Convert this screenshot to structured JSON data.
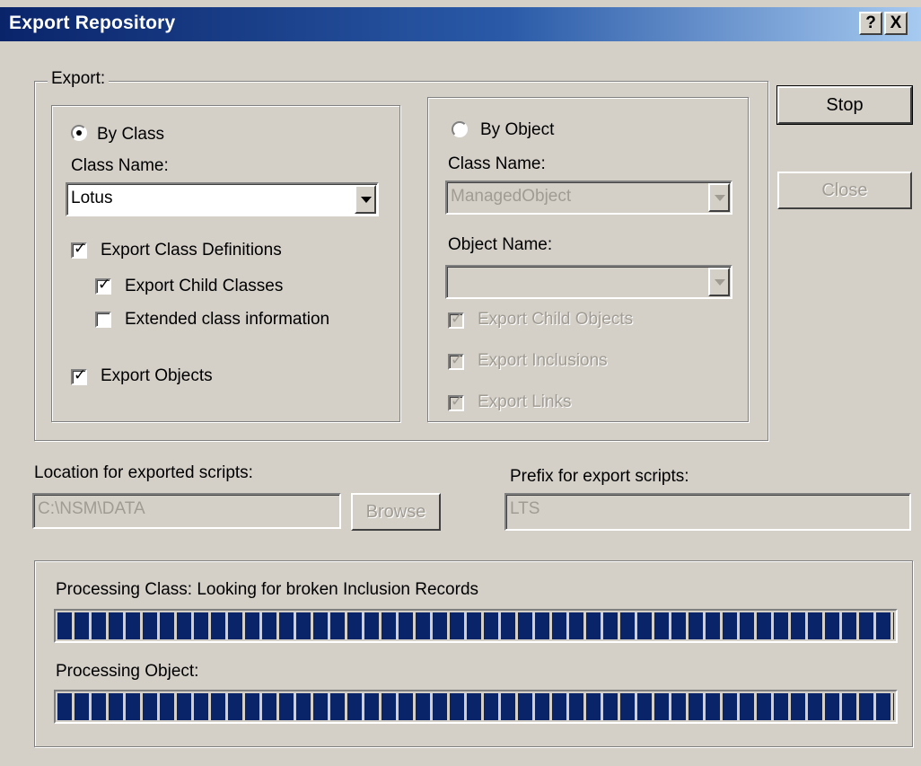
{
  "window": {
    "title": "Export Repository",
    "help_label": "?",
    "close_label": "X"
  },
  "export_group": {
    "legend": "Export:",
    "by_class": {
      "radio_label": "By Class",
      "selected": true,
      "class_name_label": "Class Name:",
      "class_name_value": "Lotus",
      "export_class_definitions": {
        "label": "Export Class Definitions",
        "checked": true
      },
      "export_child_classes": {
        "label": "Export Child Classes",
        "checked": true
      },
      "extended_class_information": {
        "label": "Extended class information",
        "checked": false
      },
      "export_objects": {
        "label": "Export Objects",
        "checked": true
      }
    },
    "by_object": {
      "radio_label": "By Object",
      "selected": false,
      "class_name_label": "Class Name:",
      "class_name_value": "ManagedObject",
      "object_name_label": "Object Name:",
      "object_name_value": "",
      "export_child_objects": {
        "label": "Export Child Objects",
        "checked": true
      },
      "export_inclusions": {
        "label": "Export Inclusions",
        "checked": true
      },
      "export_links": {
        "label": "Export Links",
        "checked": true
      }
    }
  },
  "buttons": {
    "stop": "Stop",
    "close": "Close",
    "browse": "Browse"
  },
  "location": {
    "label": "Location for exported scripts:",
    "value": "C:\\NSM\\DATA"
  },
  "prefix": {
    "label": "Prefix for export scripts:",
    "value": "LTS"
  },
  "progress": {
    "class_label": "Processing Class: Looking for broken Inclusion Records",
    "class_value": 1.0,
    "object_label": "Processing Object:",
    "object_value": 1.0
  },
  "colors": {
    "dialog_face": "#d4d0c8",
    "titlebar_start": "#0a246a",
    "titlebar_end": "#a6caf0",
    "progress_block": "#0a246a",
    "disabled_text": "#a09c94"
  }
}
